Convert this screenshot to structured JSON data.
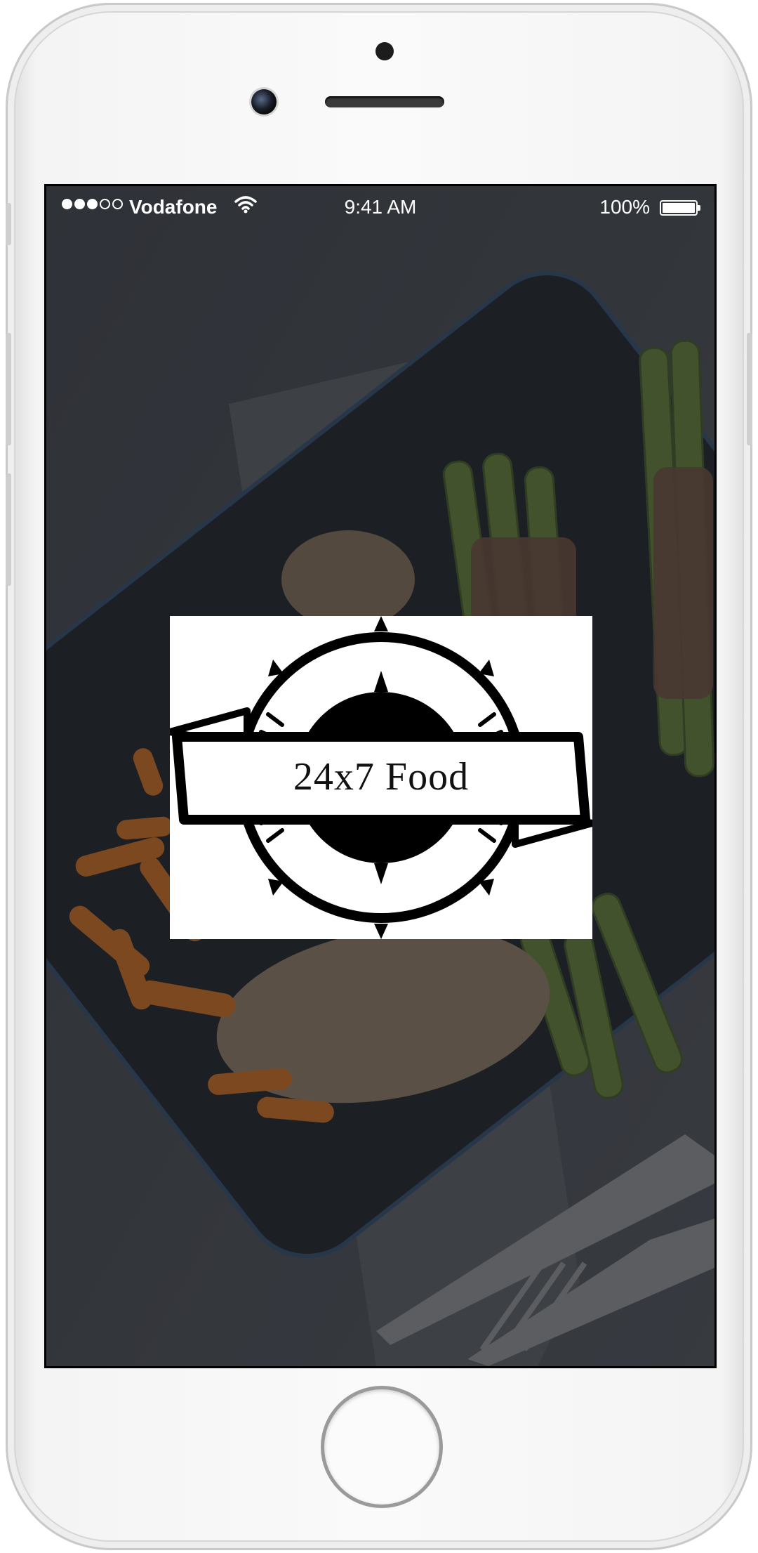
{
  "status_bar": {
    "signal_strength": "3 of 5 bars",
    "carrier": "Vodafone",
    "wifi_icon": "wifi-icon",
    "time": "9:41 AM",
    "battery_percent": "100%",
    "battery_level": 1.0
  },
  "splash": {
    "logo_text": "24x7 Food",
    "background_image": "dimmed photo of a dark plate with grilled chicken, baby carrots and bacon-wrapped asparagus, with a knife and fork",
    "overlay_color": "#1e2126"
  },
  "device": {
    "home_button_icon": "home-button",
    "front_camera_icon": "front-camera-icon"
  },
  "colors": {
    "screen_tint": "#2b2f35",
    "plate": "#1a1f24",
    "carrot": "#e07a1e",
    "asparagus": "#6f8f3c",
    "logo_ink": "#000000"
  }
}
